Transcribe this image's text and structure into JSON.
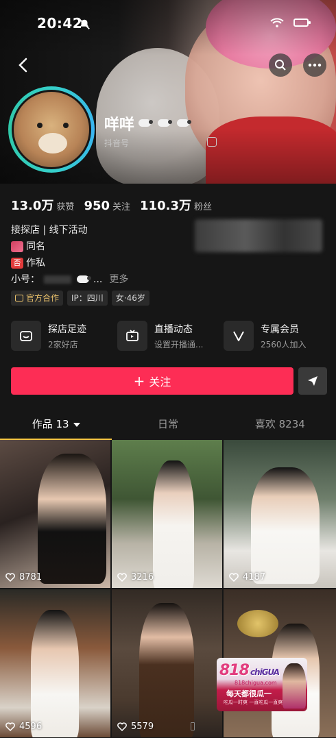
{
  "status_bar": {
    "time": "20:42"
  },
  "profile": {
    "nickname": "咩咩",
    "douyin_id_label": "抖音号",
    "stats": [
      {
        "value": "13.0万",
        "label": "获赞"
      },
      {
        "value": "950",
        "label": "关注"
      },
      {
        "value": "110.3万",
        "label": "粉丝"
      }
    ],
    "bio": {
      "line1": "接探店 | 线下活动",
      "line2": "同名",
      "line3_icon": "否",
      "line3": "作私",
      "alt_label": "小号：",
      "alt_suffix": "...",
      "more": "更多"
    },
    "tags": [
      "官方合作",
      "IP：四川",
      "女·46岁"
    ]
  },
  "features": [
    {
      "title": "探店足迹",
      "sub": "2家好店",
      "icon": "store-icon"
    },
    {
      "title": "直播动态",
      "sub": "设置开播通...",
      "icon": "tv-icon"
    },
    {
      "title": "专属会员",
      "sub": "2560人加入",
      "icon": "v-icon"
    }
  ],
  "follow_button": {
    "label": "关注"
  },
  "tabs": [
    {
      "label": "作品 13",
      "active": true
    },
    {
      "label": "日常",
      "active": false
    },
    {
      "label": "喜欢 8234",
      "active": false
    }
  ],
  "videos": [
    {
      "likes": "8781"
    },
    {
      "likes": "3216"
    },
    {
      "likes": "4187"
    },
    {
      "likes": "4596"
    },
    {
      "likes": "5579"
    },
    {
      "likes": ""
    }
  ],
  "ad": {
    "logo": "818",
    "logo_sub": "chiGUA",
    "site": "818chigua.com",
    "slogan": "每天都很瓜一",
    "sub": "吃瓜一时爽 一直吃瓜一直爽"
  },
  "colors": {
    "follow": "#fd2d55",
    "tab_underline": "#f5c542",
    "avatar_ring": "#36d0c9"
  }
}
